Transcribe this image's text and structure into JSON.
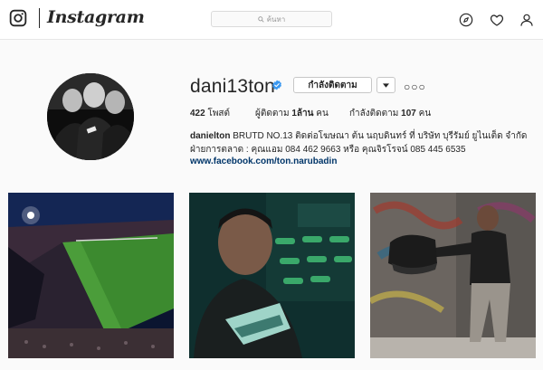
{
  "brand": {
    "name": "Instagram"
  },
  "search": {
    "placeholder": "ค้นหา"
  },
  "profile": {
    "username": "dani13ton",
    "follow_label": "กำลังติดตาม",
    "stats": {
      "posts_count": "422",
      "posts_label": "โพสต์",
      "followers_label": "ผู้ติดตาม",
      "followers_count": "1ล้าน",
      "followers_unit": "คน",
      "following_label": "กำลังติดตาม",
      "following_count": "107",
      "following_unit": "คน"
    },
    "bio": {
      "full_name": "danielton",
      "text_line1": "BRUTD NO.13 ติดต่อโฆษณา ต้น นฤบดินทร์ ที่ บริษัท บุรีรัมย์ ยูไนเต็ด จำกัด",
      "text_line2": "ฝ่ายการตลาด : คุณแอม 084 462 9663 หรือ คุณจิรโรจน์ 085 445 6535",
      "link": "www.facebook.com/ton.narubadin"
    }
  },
  "colors": {
    "link": "#003569",
    "verified": "#3897f0",
    "border": "#dbdbdb",
    "background": "#fafafa"
  },
  "icons": [
    "instagram-logo-icon",
    "search-icon",
    "compass-icon",
    "heart-icon",
    "user-icon",
    "verified-badge-icon",
    "chevron-down-icon",
    "more-options-icon"
  ],
  "posts": [
    {
      "alt": "stadium-night"
    },
    {
      "alt": "player-with-boots"
    },
    {
      "alt": "player-graffiti-wall"
    }
  ]
}
